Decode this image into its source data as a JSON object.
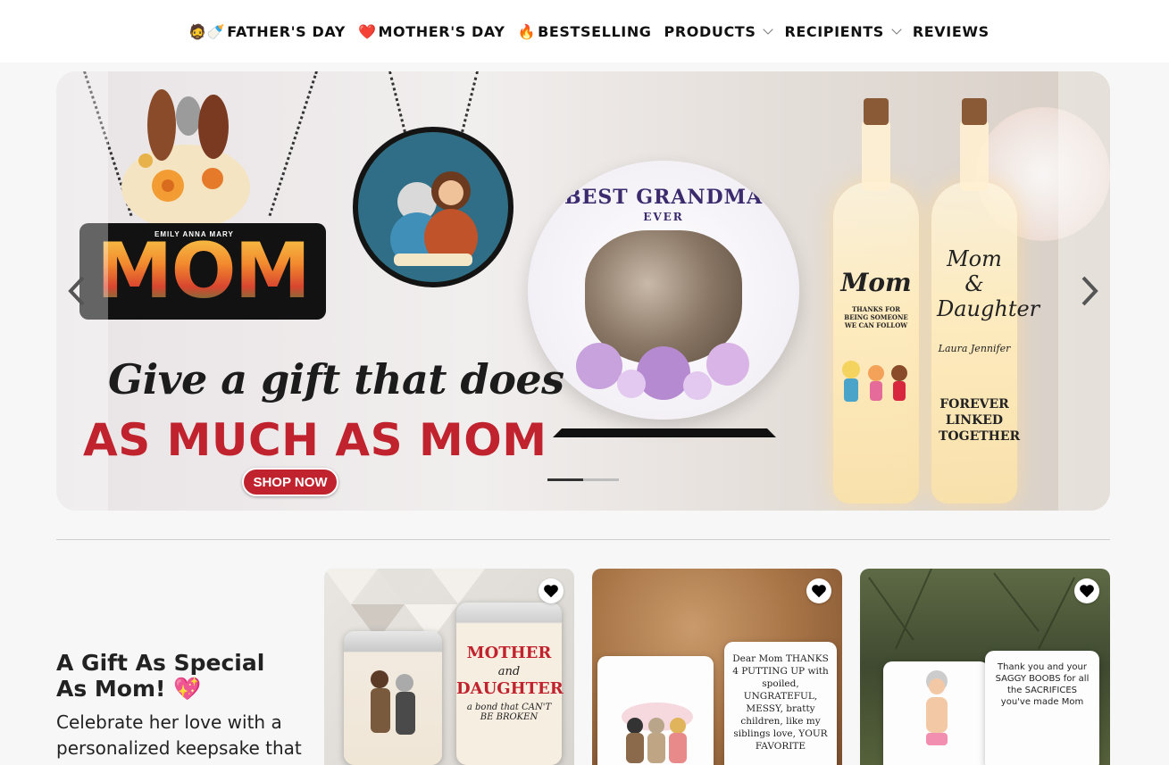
{
  "nav": {
    "items": [
      {
        "emoji": "🧔🍼",
        "label": "FATHER'S DAY"
      },
      {
        "emoji": "❤️",
        "label": "MOTHER'S DAY"
      },
      {
        "emoji": "🔥",
        "label": "BESTSELLING"
      },
      {
        "emoji": "",
        "label": "PRODUCTS",
        "dropdown": true
      },
      {
        "emoji": "",
        "label": "RECIPIENTS",
        "dropdown": true
      },
      {
        "emoji": "",
        "label": "REVIEWS"
      }
    ]
  },
  "hero": {
    "headline": "Give a gift that does",
    "subheadline": "AS MUCH AS MOM",
    "cta": "SHOP NOW",
    "mom_sign_text": "MOM",
    "mom_names": "EMILY  ANNA  MARY",
    "plate_title": "BEST GRANDMA",
    "plate_sub": "EVER",
    "bottle1_title": "Mom",
    "bottle1_text": "THANKS FOR BEING SOMEONE WE CAN FOLLOW",
    "bottle2_title": "Mom & Daughter",
    "bottle2_names": "Laura   Jennifer",
    "bottle2_text": "FOREVER LINKED TOGETHER",
    "slides": 2,
    "active_slide": 1
  },
  "intro": {
    "title": "A Gift As Special As Mom! 💖",
    "body": "Celebrate her love with a personalized keepsake that"
  },
  "cards": [
    {
      "name": "Mother and Daughter tumblers",
      "text_main": "MOTHER",
      "text_sub": "and",
      "text_main2": "DAUGHTER",
      "text_tag": "a bond that CAN'T BE BROKEN"
    },
    {
      "name": "Dear Mom mug",
      "text": "Dear Mom THANKS 4 PUTTING UP with spoiled, UNGRATEFUL, MESSY, bratty children, like my siblings love, YOUR FAVORITE"
    },
    {
      "name": "Saggy Boobs mug",
      "text": "Thank you and your SAGGY BOOBS for all the SACRIFICES you've made Mom"
    }
  ],
  "colors": {
    "accent": "#c0232d",
    "nav_bg": "#ffffff",
    "page_bg": "#f7f7f7"
  },
  "icons": {
    "prev": "chevron-left-icon",
    "next": "chevron-right-icon",
    "wishlist": "heart-icon"
  }
}
